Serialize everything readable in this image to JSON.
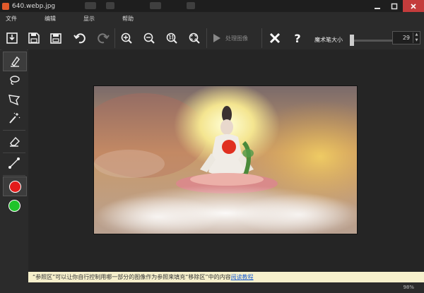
{
  "window": {
    "title": "640.webp.jpg",
    "controls": [
      "minimize",
      "maximize",
      "close"
    ]
  },
  "menu": {
    "items": [
      "文件",
      "编辑",
      "显示",
      "帮助"
    ]
  },
  "toolbar": {
    "buttons": [
      "open-icon",
      "save-icon",
      "save-as-icon",
      "undo-icon",
      "redo-icon",
      "zoom-in-icon",
      "zoom-out-icon",
      "actual-size-icon",
      "fit-icon"
    ],
    "process_label": "处理图像",
    "brush_size_label": "魔术笔大小",
    "brush_size_value": "29",
    "brush_size_fraction": 0.05
  },
  "sidebar": {
    "tools": [
      "marker-icon",
      "lasso-icon",
      "polygon-lasso-icon",
      "magic-wand-icon",
      "eraser-icon",
      "line-icon"
    ],
    "colors": [
      "#e21b1b",
      "#1ec42a"
    ]
  },
  "status": {
    "message": "“参照区”可以让你自行控制用哪一部分的图像作为参照来填充“移除区”中的内容",
    "link": "阅读教程"
  },
  "zoom": {
    "level": "98%"
  }
}
